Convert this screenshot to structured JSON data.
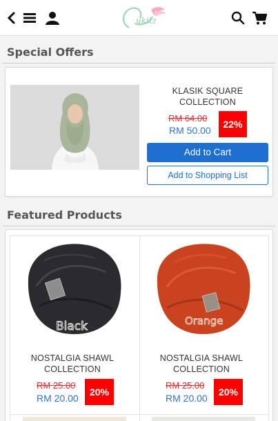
{
  "header": {
    "icons": [
      "back-icon",
      "menu-icon",
      "user-icon",
      "search-icon",
      "cart-icon"
    ],
    "logo_text": "Cukitz"
  },
  "special_offers": {
    "title": "Special Offers",
    "item": {
      "name": "KLASIK SQUARE COLLECTION",
      "old_price": "RM 64.00",
      "new_price": "RM 50.00",
      "discount": "22%",
      "add_to_cart": "Add to Cart",
      "add_to_list": "Add to Shopping List"
    }
  },
  "featured": {
    "title": "Featured Products",
    "products": [
      {
        "name": "NOSTALGIA SHAWL COLLECTION",
        "old_price": "RM 25.00",
        "new_price": "RM 20.00",
        "discount": "20%",
        "image_label": "Black",
        "color": "#2e2e30"
      },
      {
        "name": "NOSTALGIA SHAWL COLLECTION",
        "old_price": "RM 25.00",
        "new_price": "RM 20.00",
        "discount": "20%",
        "image_label": "Orange",
        "color": "#c9431f"
      }
    ]
  },
  "colors": {
    "accent": "#1e6fd0",
    "discount": "#ff0000",
    "old_price": "#e52b2b",
    "new_price": "#2f73c8"
  }
}
